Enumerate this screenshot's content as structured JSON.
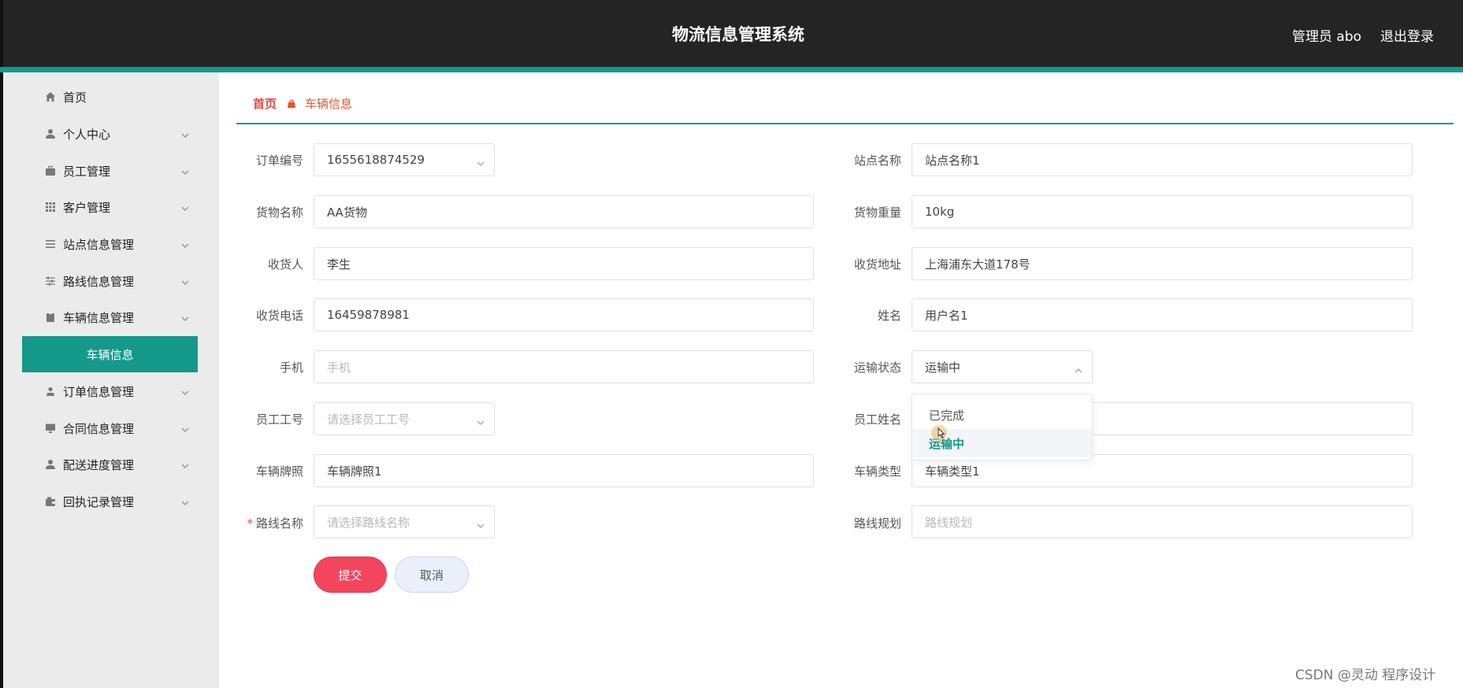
{
  "header": {
    "title": "物流信息管理系统",
    "user": "管理员 abo",
    "logout": "退出登录"
  },
  "sidebar": {
    "items": [
      {
        "label": "首页",
        "icon": "home-icon"
      },
      {
        "label": "个人中心",
        "icon": "user-icon"
      },
      {
        "label": "员工管理",
        "icon": "briefcase-icon"
      },
      {
        "label": "客户管理",
        "icon": "grid-icon"
      },
      {
        "label": "站点信息管理",
        "icon": "list-icon"
      },
      {
        "label": "路线信息管理",
        "icon": "sliders-icon"
      },
      {
        "label": "车辆信息管理",
        "icon": "clipboard-icon"
      },
      {
        "label": "订单信息管理",
        "icon": "person-icon"
      },
      {
        "label": "合同信息管理",
        "icon": "monitor-icon"
      },
      {
        "label": "配送进度管理",
        "icon": "user-icon"
      },
      {
        "label": "回执记录管理",
        "icon": "wallet-icon"
      }
    ],
    "active_sub": "车辆信息"
  },
  "breadcrumb": {
    "home": "首页",
    "current": "车辆信息"
  },
  "form": {
    "order_no": {
      "label": "订单编号",
      "value": "1655618874529"
    },
    "site_name": {
      "label": "站点名称",
      "value": "站点名称1"
    },
    "goods_name": {
      "label": "货物名称",
      "value": "AA货物"
    },
    "goods_weight": {
      "label": "货物重量",
      "value": "10kg"
    },
    "receiver": {
      "label": "收货人",
      "value": "李生"
    },
    "receive_address": {
      "label": "收货地址",
      "value": "上海浦东大道178号"
    },
    "receive_phone": {
      "label": "收货电话",
      "value": "16459878981"
    },
    "name": {
      "label": "姓名",
      "value": "用户名1"
    },
    "mobile": {
      "label": "手机",
      "placeholder": "手机"
    },
    "transport_status": {
      "label": "运输状态",
      "value": "运输中",
      "options": [
        "已完成",
        "运输中"
      ]
    },
    "staff_no": {
      "label": "员工工号",
      "placeholder": "请选择员工工号"
    },
    "staff_name": {
      "label": "员工姓名"
    },
    "plate": {
      "label": "车辆牌照",
      "value": "车辆牌照1"
    },
    "vehicle_type": {
      "label": "车辆类型",
      "value": "车辆类型1"
    },
    "route_name": {
      "label": "路线名称",
      "required": "*",
      "placeholder": "请选择路线名称"
    },
    "route_plan": {
      "label": "路线规划",
      "placeholder": "路线规划"
    }
  },
  "buttons": {
    "submit": "提交",
    "cancel": "取消"
  },
  "watermark": "CSDN @灵动 程序设计",
  "colors": {
    "accent": "#14998a",
    "header_bg": "#242424",
    "submit": "#f3455d",
    "breadcrumb": "#e6552f"
  }
}
